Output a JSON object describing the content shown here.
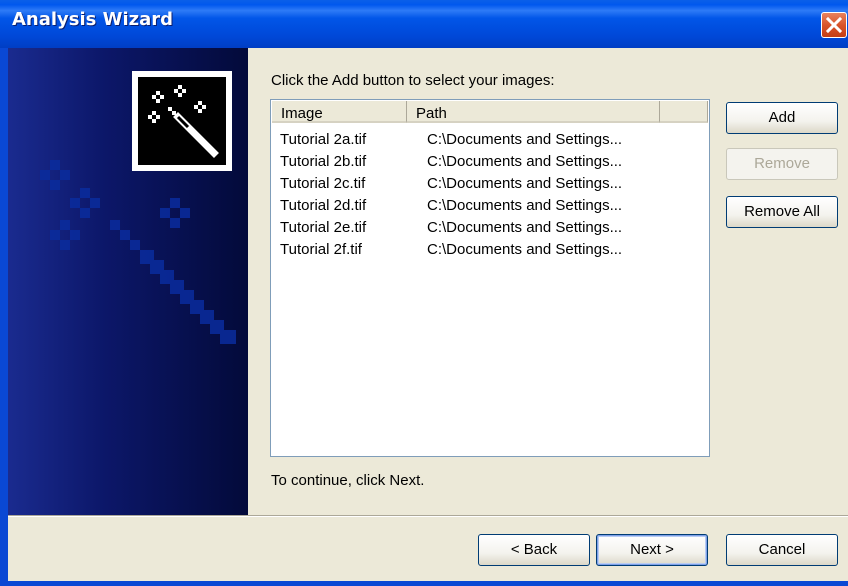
{
  "window": {
    "title": "Analysis Wizard"
  },
  "instruction": "Click the Add button to select your images:",
  "list": {
    "columns": [
      "Image",
      "Path"
    ],
    "rows": [
      {
        "image": "Tutorial 2a.tif",
        "path": "C:\\Documents and Settings..."
      },
      {
        "image": "Tutorial 2b.tif",
        "path": "C:\\Documents and Settings..."
      },
      {
        "image": "Tutorial 2c.tif",
        "path": "C:\\Documents and Settings..."
      },
      {
        "image": "Tutorial 2d.tif",
        "path": "C:\\Documents and Settings..."
      },
      {
        "image": "Tutorial 2e.tif",
        "path": "C:\\Documents and Settings..."
      },
      {
        "image": "Tutorial 2f.tif",
        "path": "C:\\Documents and Settings..."
      }
    ]
  },
  "side_buttons": {
    "add": "Add",
    "remove": "Remove",
    "remove_all": "Remove All"
  },
  "footer_hint": "To continue, click Next.",
  "nav": {
    "back": "< Back",
    "next": "Next >",
    "cancel": "Cancel"
  },
  "icons": {
    "close": "close-icon",
    "wizard": "magic-wand-icon"
  },
  "colors": {
    "title_bar": "#0054E3",
    "side_panel": "#0C1769",
    "dialog_bg": "#ECE9D8",
    "close_button": "#D9542B"
  }
}
